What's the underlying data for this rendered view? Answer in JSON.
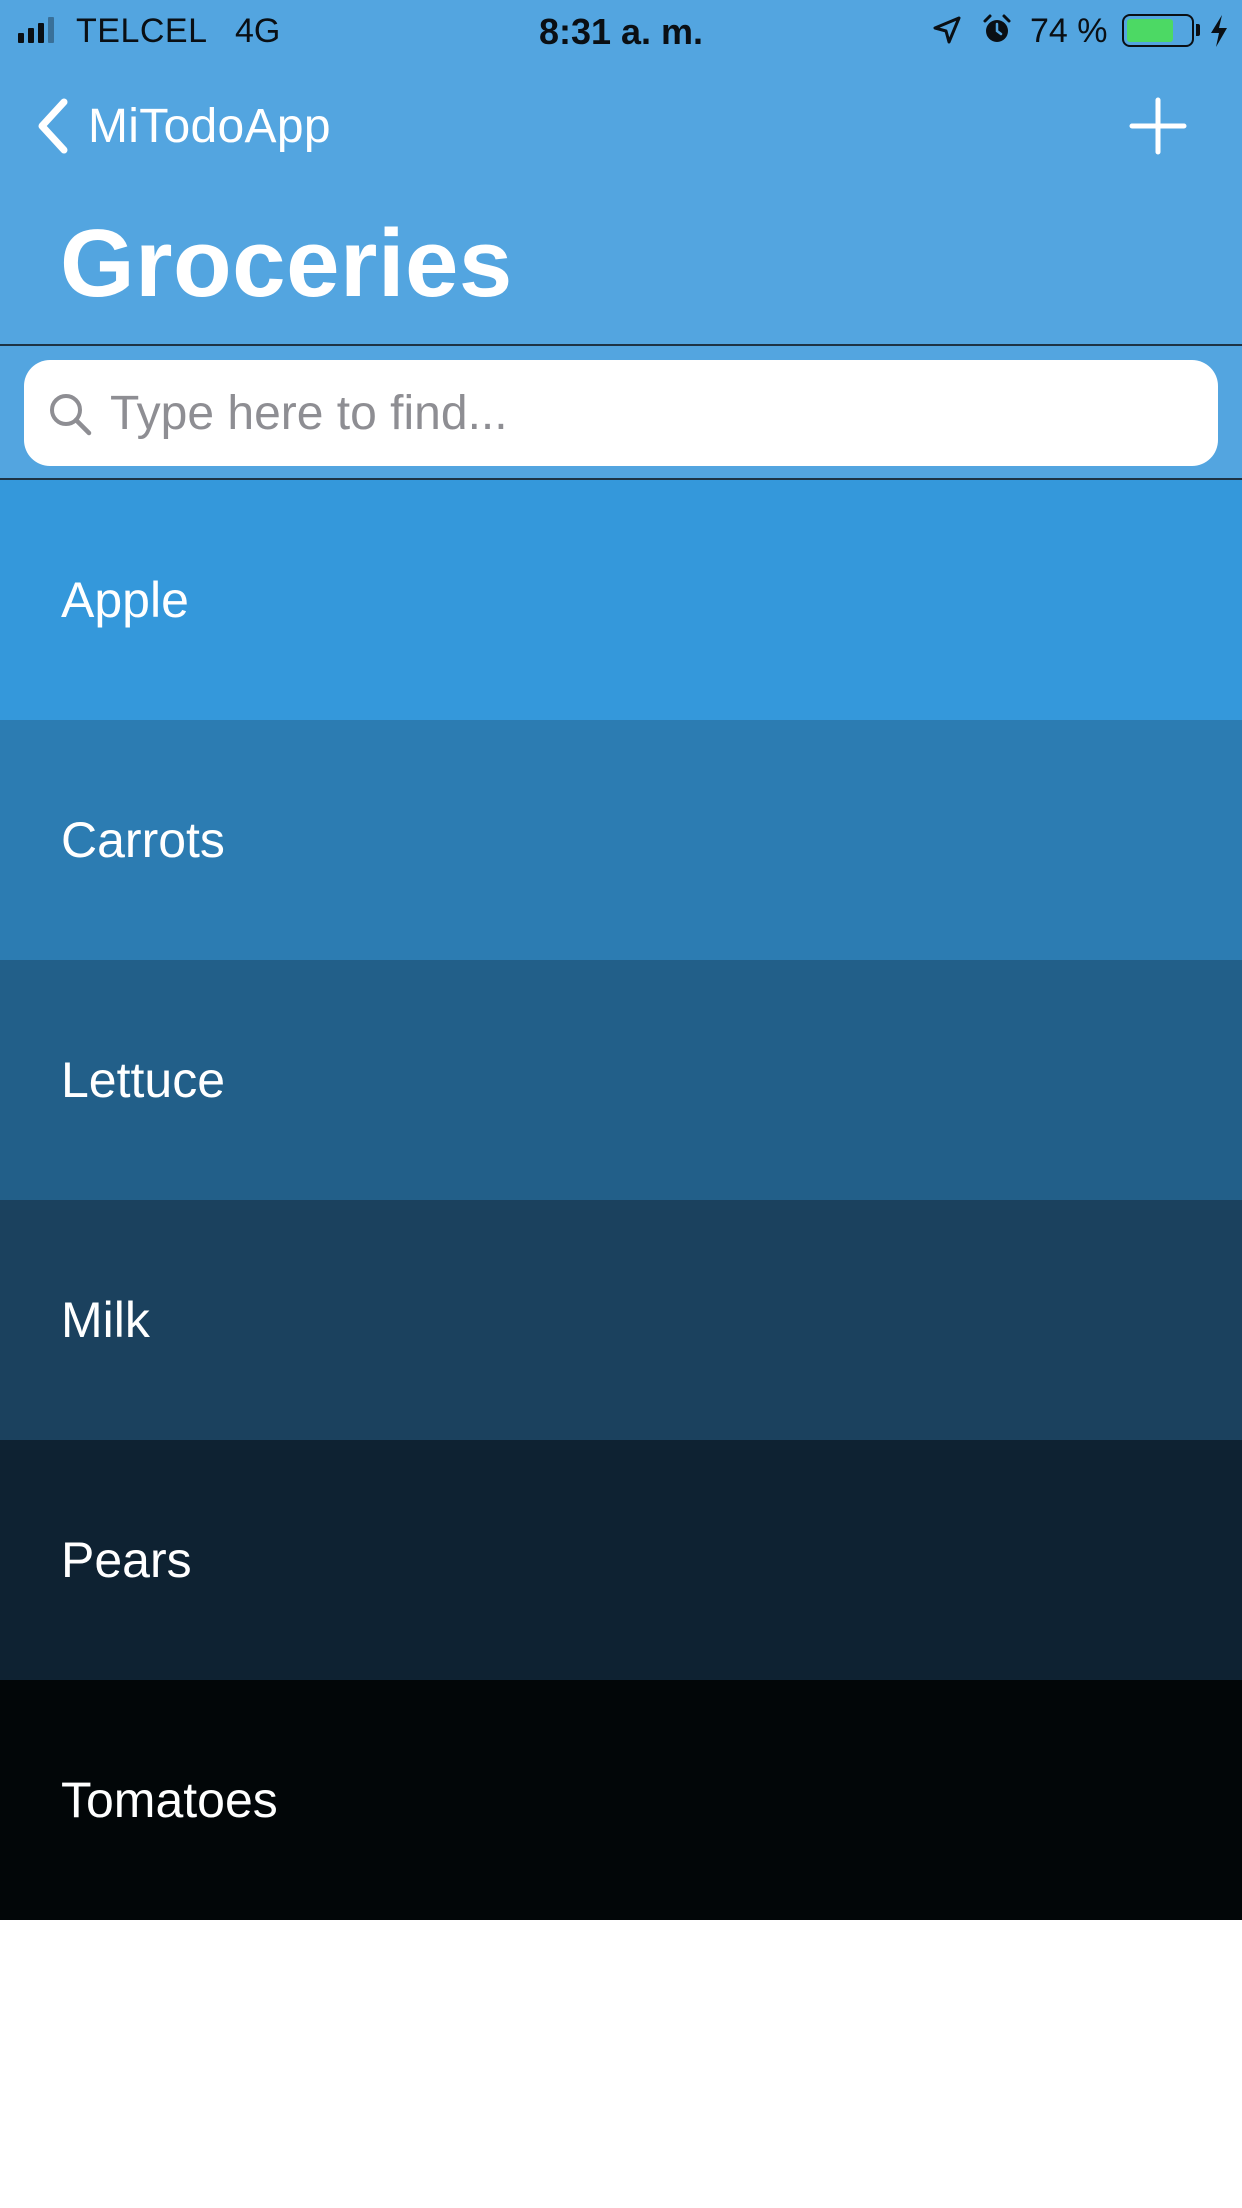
{
  "status_bar": {
    "carrier": "TELCEL",
    "network": "4G",
    "time": "8:31 a. m.",
    "battery_percent_text": "74 %",
    "battery_level": 0.74,
    "battery_color": "#4CD964",
    "icons": [
      "signal-icon",
      "location-icon",
      "alarm-icon",
      "battery-icon",
      "charging-icon"
    ]
  },
  "nav": {
    "back_label": "MiTodoApp",
    "back_icon": "chevron-left-icon",
    "add_icon": "plus-icon"
  },
  "page": {
    "title": "Groceries"
  },
  "search": {
    "placeholder": "Type here to find...",
    "value": "",
    "icon": "search-icon"
  },
  "colors": {
    "header_background": "#53A5E0",
    "text_on_color": "#FFFFFF"
  },
  "items": [
    {
      "label": "Apple",
      "color": "#3498DB"
    },
    {
      "label": "Carrots",
      "color": "#2C7CB2"
    },
    {
      "label": "Lettuce",
      "color": "#225F89"
    },
    {
      "label": "Milk",
      "color": "#1B415E"
    },
    {
      "label": "Pears",
      "color": "#0E2232"
    },
    {
      "label": "Tomatoes",
      "color": "#020608"
    }
  ]
}
